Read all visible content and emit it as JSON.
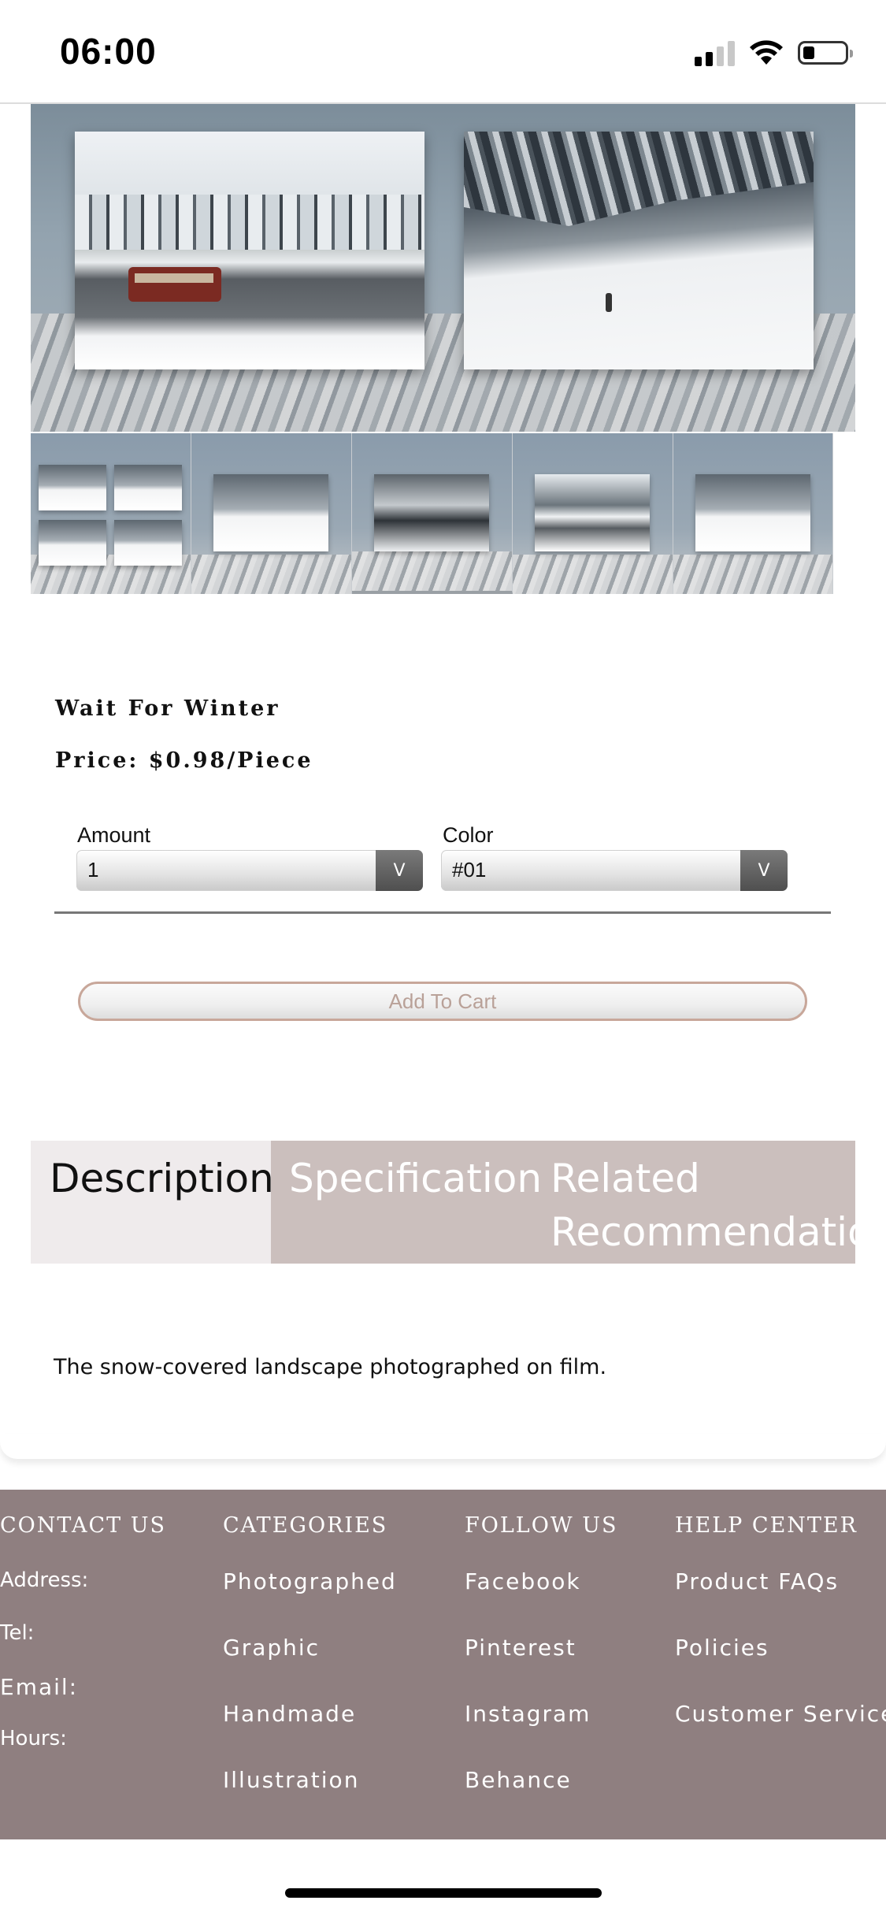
{
  "status_bar": {
    "time": "06:00"
  },
  "product": {
    "title": "Wait For Winter",
    "price": "Price: $0.98/Piece",
    "amount_label": "Amount",
    "amount_value": "1",
    "color_label": "Color",
    "color_value": "#01",
    "select_arrow": "V",
    "add_to_cart": "Add To Cart"
  },
  "tabs": {
    "description": "Description",
    "specification": "Specification",
    "related_line1": "Related",
    "related_line2": "Recommendation"
  },
  "description_text": "The snow-covered landscape photographed on film.",
  "footer": {
    "contact": {
      "heading": "CONTACT US",
      "items": [
        "Address:",
        "Tel:",
        "Email:",
        "Hours:"
      ]
    },
    "categories": {
      "heading": "CATEGORIES",
      "items": [
        "Photographed",
        "Graphic",
        "Handmade",
        "Illustration"
      ]
    },
    "follow": {
      "heading": "FOLLOW US",
      "items": [
        "Facebook",
        "Pinterest",
        "Instagram",
        "Behance"
      ]
    },
    "help": {
      "heading": "HELP CENTER",
      "items": [
        "Product FAQs",
        "Policies",
        "Customer Service"
      ]
    }
  },
  "colors": {
    "tab_active_bg": "#efebec",
    "tab_bg": "#cbbfbd",
    "footer_bg": "#8f7f80",
    "cart_border": "#c8a79a"
  }
}
